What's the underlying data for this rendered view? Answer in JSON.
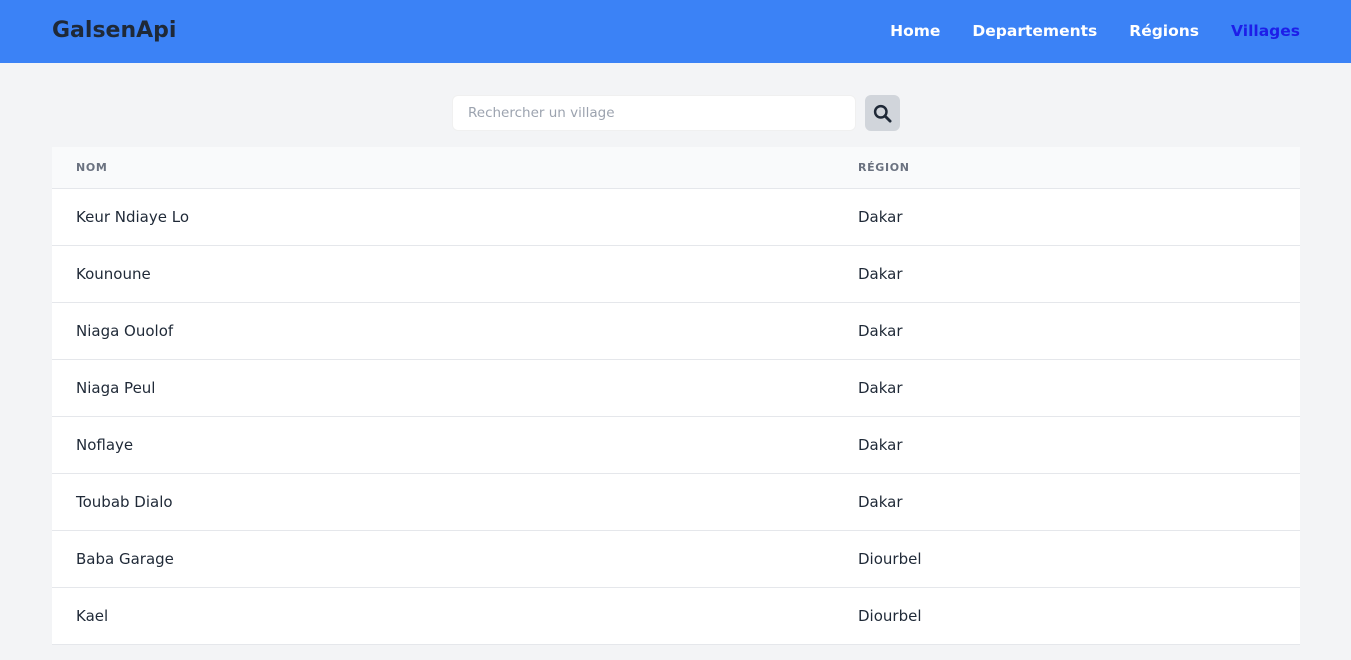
{
  "brand": "GalsenApi",
  "nav": {
    "home": "Home",
    "departements": "Departements",
    "regions": "Régions",
    "villages": "Villages"
  },
  "search": {
    "placeholder": "Rechercher un village",
    "value": "",
    "button_icon": "search-icon"
  },
  "table": {
    "headers": {
      "nom": "NOM",
      "region": "RÉGION"
    },
    "rows": [
      {
        "nom": "Keur Ndiaye Lo",
        "region": "Dakar"
      },
      {
        "nom": "Kounoune",
        "region": "Dakar"
      },
      {
        "nom": "Niaga Ouolof",
        "region": "Dakar"
      },
      {
        "nom": "Niaga Peul",
        "region": "Dakar"
      },
      {
        "nom": "Noflaye",
        "region": "Dakar"
      },
      {
        "nom": "Toubab Dialo",
        "region": "Dakar"
      },
      {
        "nom": "Baba Garage",
        "region": "Diourbel"
      },
      {
        "nom": "Kael",
        "region": "Diourbel"
      }
    ]
  },
  "colors": {
    "navbar": "#3b82f6",
    "active_link": "#1d1ee8",
    "page_bg": "#f3f4f6",
    "search_button": "#d1d5db"
  }
}
